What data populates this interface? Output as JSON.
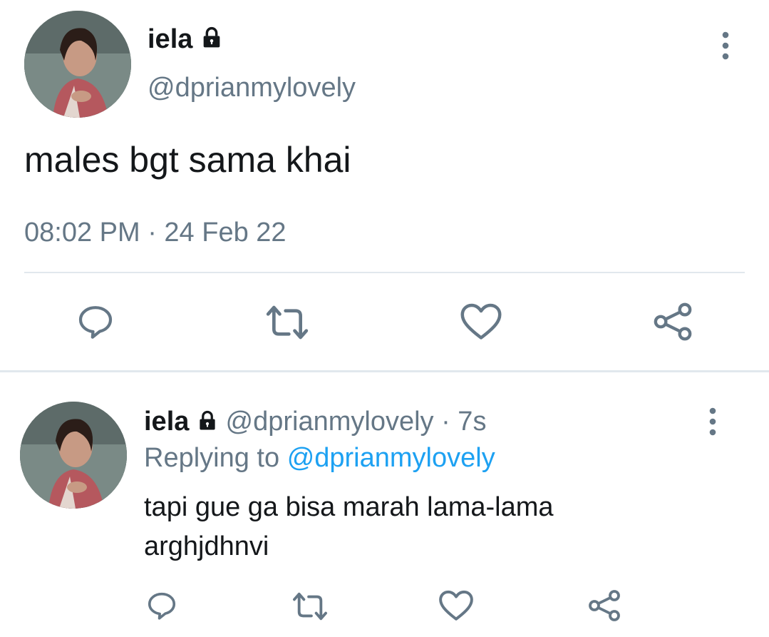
{
  "main_tweet": {
    "display_name": "iela",
    "handle": "@dprianmylovely",
    "text": "males bgt sama khai",
    "timestamp": "08:02 PM · 24 Feb 22"
  },
  "reply_tweet": {
    "display_name": "iela",
    "handle": "@dprianmylovely",
    "time_ago": "· 7s",
    "replying_label": "Replying to",
    "replying_handle": "@dprianmylovely",
    "text_line1": "tapi gue ga bisa marah lama-lama",
    "text_line2": "arghjdhnvi"
  },
  "icons": {
    "reply": "reply-icon",
    "retweet": "retweet-icon",
    "like": "heart-icon",
    "share": "share-icon",
    "more": "more-vertical-icon",
    "lock": "lock-icon"
  },
  "colors": {
    "text": "#14171a",
    "muted": "#657786",
    "link": "#1da1f2",
    "divider": "#e1e8ed"
  }
}
